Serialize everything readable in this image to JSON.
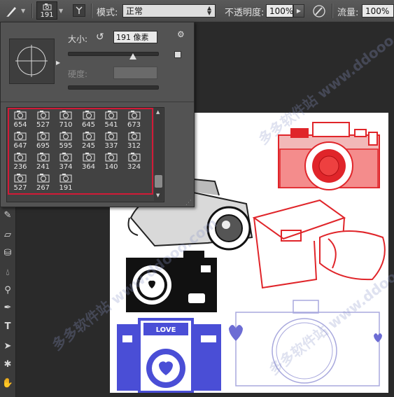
{
  "options_bar": {
    "brush_size": "191",
    "mode_label": "模式:",
    "mode_value": "正常",
    "opacity_label": "不透明度:",
    "opacity_value": "100%",
    "flow_label": "流量:",
    "flow_value": "100%"
  },
  "brush_picker": {
    "size_label": "大小:",
    "size_value": "191 像素",
    "hardness_label": "硬度:",
    "brushes": [
      {
        "num": "654"
      },
      {
        "num": "527"
      },
      {
        "num": "710"
      },
      {
        "num": "645"
      },
      {
        "num": "541"
      },
      {
        "num": "673"
      },
      {
        "num": "647"
      },
      {
        "num": "695"
      },
      {
        "num": "595"
      },
      {
        "num": "245"
      },
      {
        "num": "337"
      },
      {
        "num": "312"
      },
      {
        "num": "236"
      },
      {
        "num": "241"
      },
      {
        "num": "374"
      },
      {
        "num": "364"
      },
      {
        "num": "140"
      },
      {
        "num": "324"
      },
      {
        "num": "527"
      },
      {
        "num": "267"
      },
      {
        "num": "191"
      }
    ]
  },
  "canvas": {
    "love_text": "LOVE",
    "colors": {
      "red": "#e0252a",
      "blue": "#4a4ed6",
      "black": "#111111",
      "lavender": "#a8a8dd"
    }
  },
  "watermark": "多多软件站  www.ddooo.com",
  "icons": [
    "brush-tool-icon",
    "brush-settings-toggle-icon",
    "airbrush-icon",
    "reset-size-icon",
    "gear-icon",
    "new-preset-icon"
  ]
}
